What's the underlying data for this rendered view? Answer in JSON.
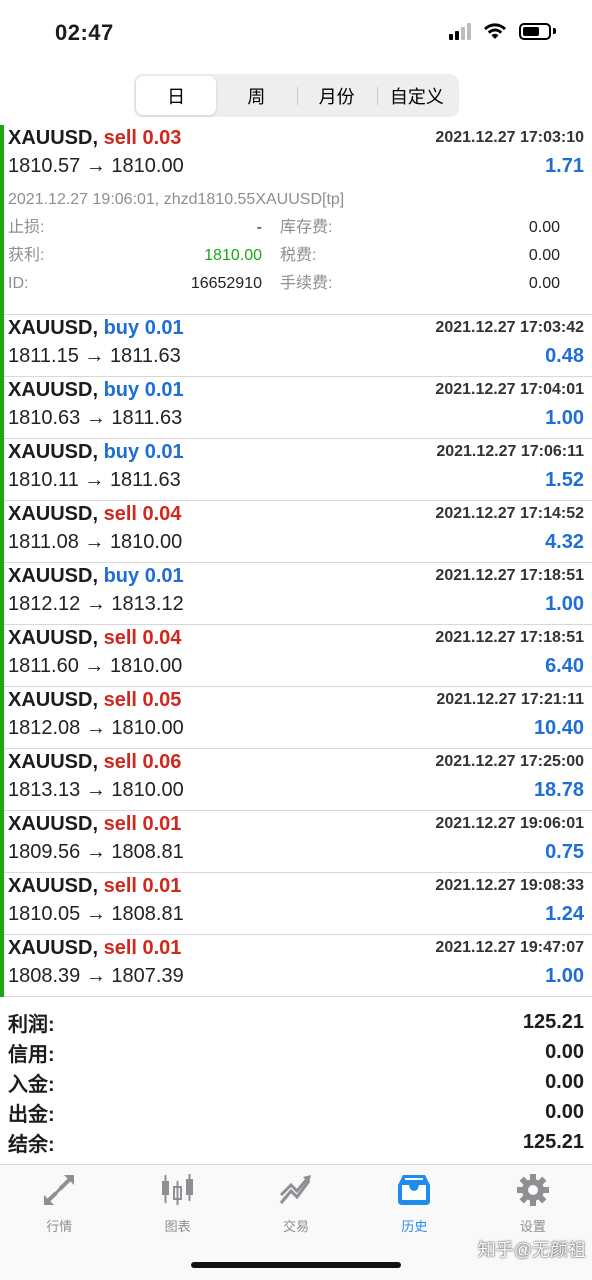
{
  "status_bar": {
    "time": "02:47",
    "battery_level": 0.68
  },
  "segments": [
    {
      "label": "日",
      "active": true
    },
    {
      "label": "周",
      "active": false
    },
    {
      "label": "月份",
      "active": false
    },
    {
      "label": "自定义",
      "active": false
    }
  ],
  "deals": [
    {
      "symbol": "XAUUSD,",
      "type": "sell",
      "volume": "0.03",
      "time": "2021.12.27 17:03:10",
      "open": "1810.57",
      "arrow": "→",
      "close": "1810.00",
      "profit": "1.71",
      "detail": {
        "comment": "2021.12.27 19:06:01, zhzd1810.55XAUUSD[tp]",
        "sl_label": "止损:",
        "sl": "-",
        "swap_label": "库存费:",
        "swap": "0.00",
        "tp_label": "获利:",
        "tp": "1810.00",
        "tax_label": "税费:",
        "tax": "0.00",
        "id_label": "ID:",
        "id": "16652910",
        "fee_label": "手续费:",
        "fee": "0.00"
      }
    },
    {
      "symbol": "XAUUSD,",
      "type": "buy",
      "volume": "0.01",
      "time": "2021.12.27 17:03:42",
      "open": "1811.15",
      "arrow": "→",
      "close": "1811.63",
      "profit": "0.48"
    },
    {
      "symbol": "XAUUSD,",
      "type": "buy",
      "volume": "0.01",
      "time": "2021.12.27 17:04:01",
      "open": "1810.63",
      "arrow": "→",
      "close": "1811.63",
      "profit": "1.00"
    },
    {
      "symbol": "XAUUSD,",
      "type": "buy",
      "volume": "0.01",
      "time": "2021.12.27 17:06:11",
      "open": "1810.11",
      "arrow": "→",
      "close": "1811.63",
      "profit": "1.52"
    },
    {
      "symbol": "XAUUSD,",
      "type": "sell",
      "volume": "0.04",
      "time": "2021.12.27 17:14:52",
      "open": "1811.08",
      "arrow": "→",
      "close": "1810.00",
      "profit": "4.32"
    },
    {
      "symbol": "XAUUSD,",
      "type": "buy",
      "volume": "0.01",
      "time": "2021.12.27 17:18:51",
      "open": "1812.12",
      "arrow": "→",
      "close": "1813.12",
      "profit": "1.00"
    },
    {
      "symbol": "XAUUSD,",
      "type": "sell",
      "volume": "0.04",
      "time": "2021.12.27 17:18:51",
      "open": "1811.60",
      "arrow": "→",
      "close": "1810.00",
      "profit": "6.40"
    },
    {
      "symbol": "XAUUSD,",
      "type": "sell",
      "volume": "0.05",
      "time": "2021.12.27 17:21:11",
      "open": "1812.08",
      "arrow": "→",
      "close": "1810.00",
      "profit": "10.40"
    },
    {
      "symbol": "XAUUSD,",
      "type": "sell",
      "volume": "0.06",
      "time": "2021.12.27 17:25:00",
      "open": "1813.13",
      "arrow": "→",
      "close": "1810.00",
      "profit": "18.78"
    },
    {
      "symbol": "XAUUSD,",
      "type": "sell",
      "volume": "0.01",
      "time": "2021.12.27 19:06:01",
      "open": "1809.56",
      "arrow": "→",
      "close": "1808.81",
      "profit": "0.75"
    },
    {
      "symbol": "XAUUSD,",
      "type": "sell",
      "volume": "0.01",
      "time": "2021.12.27 19:08:33",
      "open": "1810.05",
      "arrow": "→",
      "close": "1808.81",
      "profit": "1.24"
    },
    {
      "symbol": "XAUUSD,",
      "type": "sell",
      "volume": "0.01",
      "time": "2021.12.27 19:47:07",
      "open": "1808.39",
      "arrow": "→",
      "close": "1807.39",
      "profit": "1.00"
    }
  ],
  "summary": [
    {
      "label": "利润:",
      "value": "125.21"
    },
    {
      "label": "信用:",
      "value": "0.00"
    },
    {
      "label": "入金:",
      "value": "0.00"
    },
    {
      "label": "出金:",
      "value": "0.00"
    },
    {
      "label": "结余:",
      "value": "125.21"
    }
  ],
  "tabs": [
    {
      "label": "行情",
      "icon": "quotes-arrows-icon",
      "active": false
    },
    {
      "label": "图表",
      "icon": "candlestick-chart-icon",
      "active": false
    },
    {
      "label": "交易",
      "icon": "trade-trend-icon",
      "active": false
    },
    {
      "label": "历史",
      "icon": "history-inbox-icon",
      "active": true
    },
    {
      "label": "设置",
      "icon": "gear-icon",
      "active": false
    }
  ],
  "watermark": "知乎@无颜祖",
  "colors": {
    "sell": "#d1281c",
    "buy": "#1f6ed6",
    "profit": "#1f6ed6",
    "accent_bar": "#1aa80e",
    "tab_active": "#1f8bef"
  }
}
